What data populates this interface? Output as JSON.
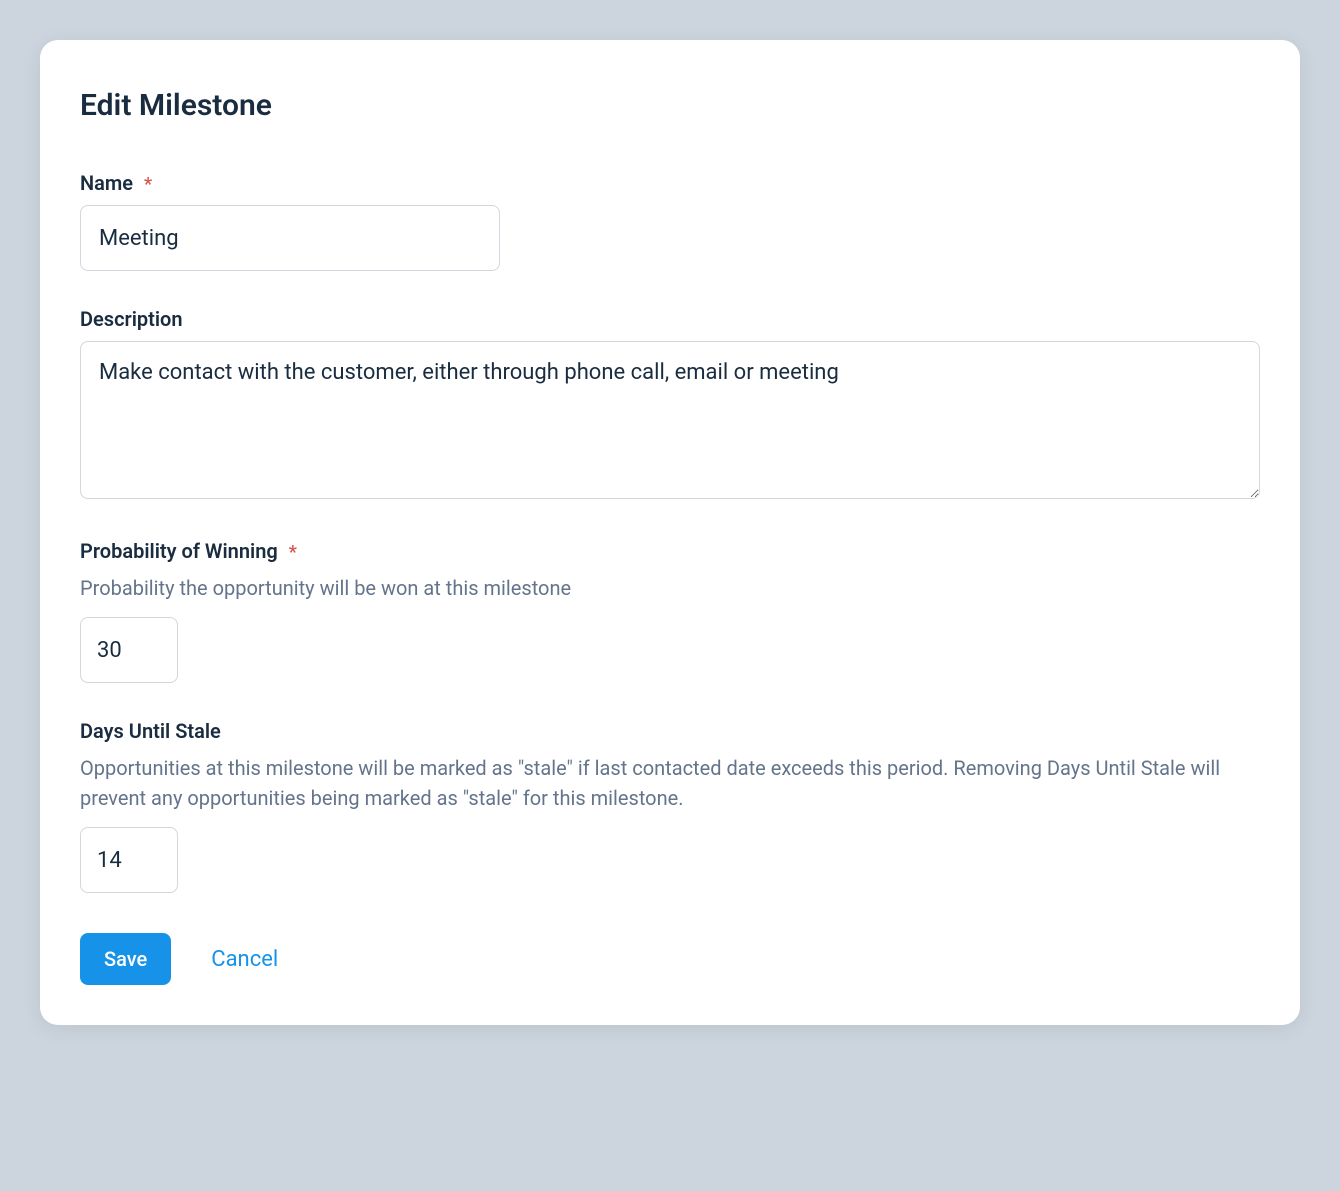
{
  "form": {
    "title": "Edit Milestone",
    "name": {
      "label": "Name",
      "required": true,
      "value": "Meeting"
    },
    "description": {
      "label": "Description",
      "required": false,
      "value": "Make contact with the customer, either through phone call, email or meeting"
    },
    "probability": {
      "label": "Probability of Winning",
      "required": true,
      "help_text": "Probability the opportunity will be won at this milestone",
      "value": "30"
    },
    "days_until_stale": {
      "label": "Days Until Stale",
      "required": false,
      "help_text": "Opportunities at this milestone will be marked as \"stale\" if last contacted date exceeds this period. Removing Days Until Stale will prevent any opportunities being marked as \"stale\" for this milestone.",
      "value": "14"
    },
    "buttons": {
      "save_label": "Save",
      "cancel_label": "Cancel"
    },
    "required_marker": "*"
  }
}
